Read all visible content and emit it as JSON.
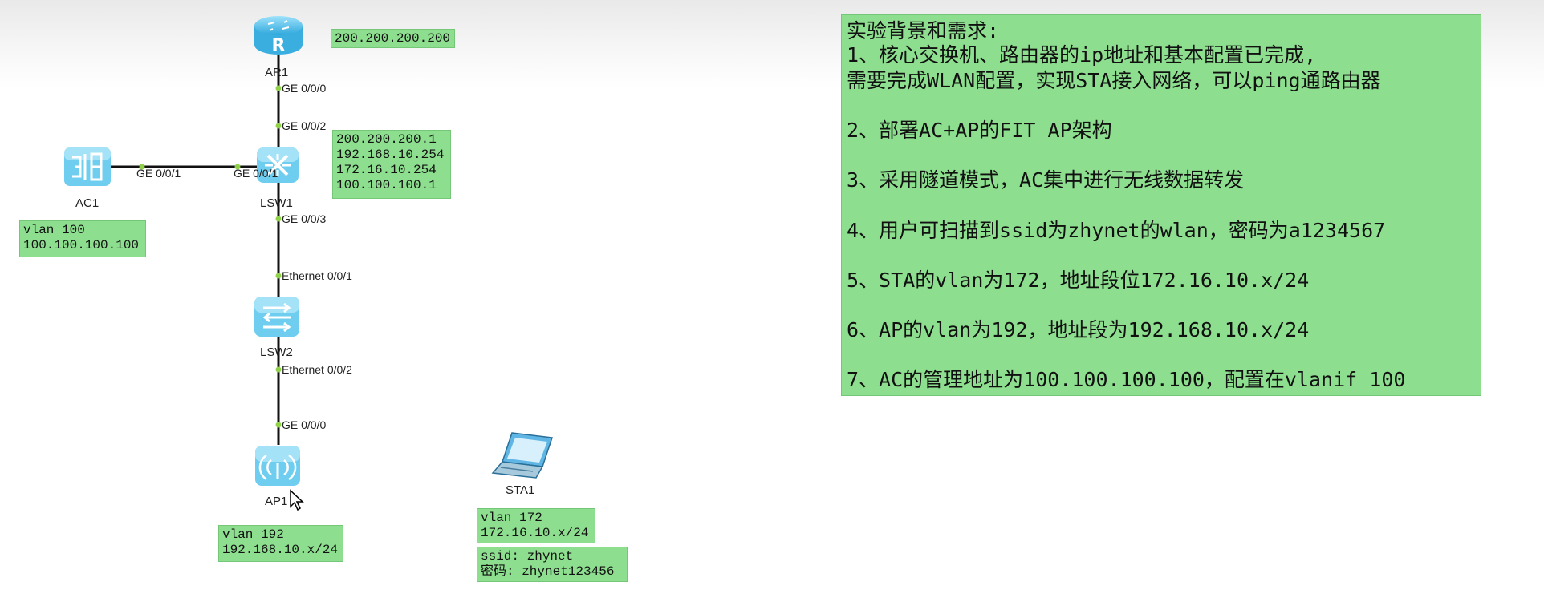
{
  "devices": {
    "ar1": "AR1",
    "lsw1": "LSW1",
    "ac1": "AC1",
    "lsw2": "LSW2",
    "ap1": "AP1",
    "sta1": "STA1"
  },
  "ports": {
    "ar1_ge000": "GE 0/0/0",
    "lsw1_ge002": "GE 0/0/2",
    "ac1_ge001": "GE 0/0/1",
    "lsw1_ge001": "GE 0/0/1",
    "lsw1_ge003": "GE 0/0/3",
    "lsw2_eth001": "Ethernet 0/0/1",
    "lsw2_eth002": "Ethernet 0/0/2",
    "ap1_ge000": "GE 0/0/0"
  },
  "notes": {
    "ar1": [
      "200.200.200.200"
    ],
    "lsw1": [
      "200.200.200.1",
      "192.168.10.254",
      "172.16.10.254",
      "100.100.100.1"
    ],
    "ac1": [
      "vlan 100",
      "100.100.100.100"
    ],
    "ap1": [
      "vlan 192",
      "192.168.10.x/24"
    ],
    "sta1": [
      "vlan 172",
      "172.16.10.x/24"
    ],
    "sta1_wifi": [
      "ssid: zhynet",
      "密码: zhynet123456"
    ]
  },
  "requirements": {
    "title": "实验背景和需求:",
    "items": [
      "1、核心交换机、路由器的ip地址和基本配置已完成,",
      "需要完成WLAN配置，实现STA接入网络，可以ping通路由器",
      "2、部署AC+AP的FIT AP架构",
      "3、采用隧道模式，AC集中进行无线数据转发",
      "4、用户可扫描到ssid为zhynet的wlan，密码为a1234567",
      "5、STA的vlan为172，地址段位172.16.10.x/24",
      "6、AP的vlan为192，地址段为192.168.10.x/24",
      "7、AC的管理地址为100.100.100.100，配置在vlanif 100"
    ]
  },
  "colors": {
    "note_bg": "#8ddf8f",
    "device_blue": "#5cc7ee",
    "link": "#000000",
    "port_dot": "#8fd24a"
  }
}
